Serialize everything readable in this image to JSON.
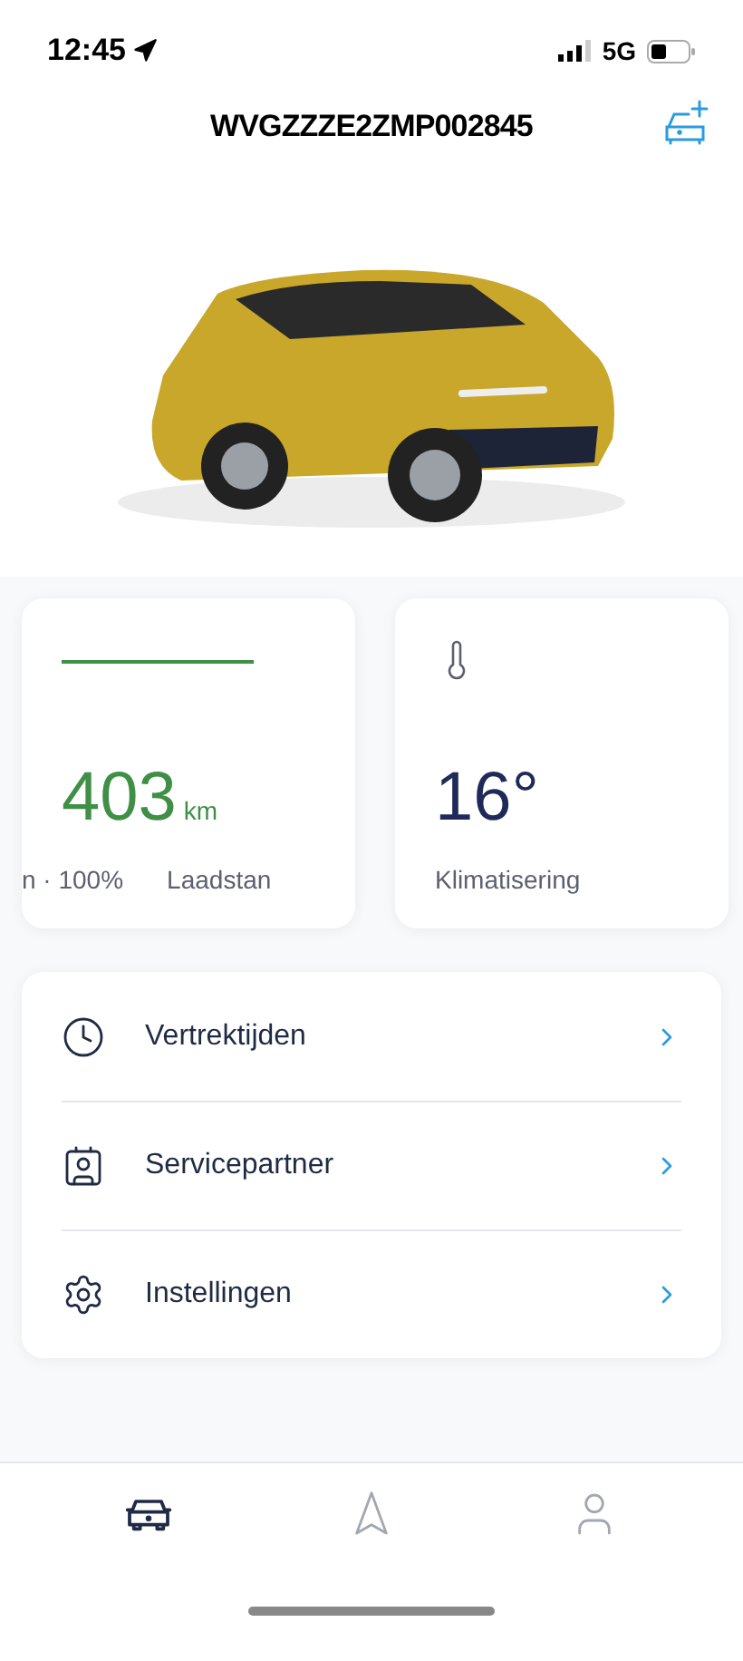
{
  "status_bar": {
    "time": "12:45",
    "network": "5G"
  },
  "header": {
    "title": "WVGZZZE2ZMP002845"
  },
  "cards": [
    {
      "kind": "range",
      "value": "403",
      "unit": "km",
      "caption": "n · 100%",
      "caption_2": "Laadstan"
    },
    {
      "kind": "climate",
      "value": "16°",
      "caption": "Klimatisering"
    }
  ],
  "menu": [
    {
      "kind": "clock",
      "label": "Vertrektijden"
    },
    {
      "kind": "partner",
      "label": "Servicepartner"
    },
    {
      "kind": "settings",
      "label": "Instellingen"
    }
  ],
  "tab_bar": [
    {
      "kind": "car",
      "selected": true
    },
    {
      "kind": "navigation",
      "selected": false
    },
    {
      "kind": "profile",
      "selected": false
    }
  ]
}
